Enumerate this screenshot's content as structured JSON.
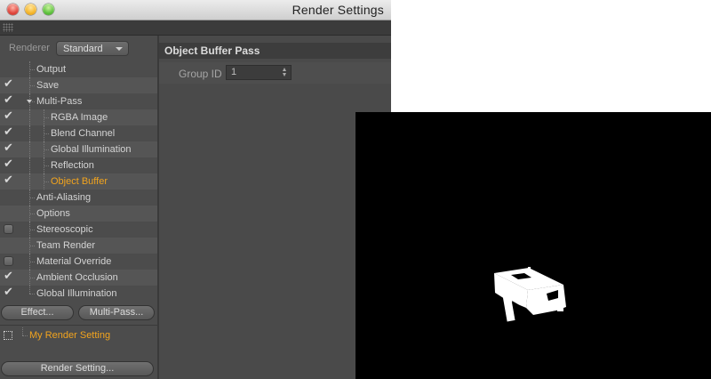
{
  "window": {
    "title": "Render Settings"
  },
  "renderer": {
    "label": "Renderer",
    "value": "Standard"
  },
  "tree": [
    {
      "label": "Output",
      "checkbox": "none",
      "level": 0
    },
    {
      "label": "Save",
      "checkbox": "checked",
      "level": 0
    },
    {
      "label": "Multi-Pass",
      "checkbox": "checked",
      "level": 0,
      "expanded": true
    },
    {
      "label": "RGBA Image",
      "checkbox": "checked",
      "level": 1
    },
    {
      "label": "Blend Channel",
      "checkbox": "checked",
      "level": 1
    },
    {
      "label": "Global Illumination",
      "checkbox": "checked",
      "level": 1
    },
    {
      "label": "Reflection",
      "checkbox": "checked",
      "level": 1
    },
    {
      "label": "Object Buffer",
      "checkbox": "checked",
      "level": 1,
      "active": true
    },
    {
      "label": "Anti-Aliasing",
      "checkbox": "none",
      "level": 0
    },
    {
      "label": "Options",
      "checkbox": "none",
      "level": 0
    },
    {
      "label": "Stereoscopic",
      "checkbox": "empty",
      "level": 0
    },
    {
      "label": "Team Render",
      "checkbox": "none",
      "level": 0
    },
    {
      "label": "Material Override",
      "checkbox": "empty",
      "level": 0
    },
    {
      "label": "Ambient Occlusion",
      "checkbox": "checked",
      "level": 0
    },
    {
      "label": "Global Illumination",
      "checkbox": "checked",
      "level": 0
    }
  ],
  "buttons": {
    "effect": "Effect...",
    "multipass": "Multi-Pass...",
    "render_setting": "Render Setting..."
  },
  "render_setting_name": "My Render Setting",
  "panel": {
    "section_title": "Object Buffer Pass",
    "group_id_label": "Group ID",
    "group_id_value": "1"
  },
  "colors": {
    "active_text": "#f2a41e"
  },
  "icons": {
    "checkmark": "✔"
  }
}
